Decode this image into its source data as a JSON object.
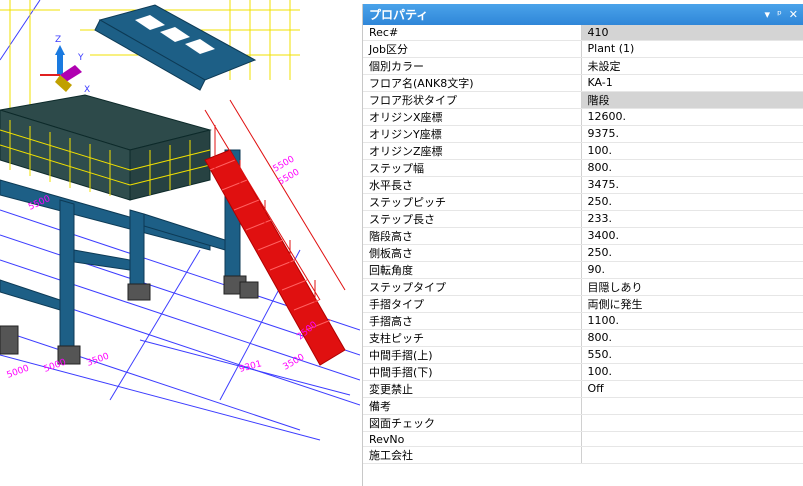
{
  "panel": {
    "title": "プロパティ",
    "controls": [
      "▾",
      "ᵖ",
      "✕"
    ],
    "rows": [
      {
        "key": "Rec#",
        "value": "410"
      },
      {
        "key": "Job区分",
        "value": "Plant (1)"
      },
      {
        "key": "個別カラー",
        "value": "未設定"
      },
      {
        "key": "フロア名(ANK8文字)",
        "value": "KA-1"
      },
      {
        "key": "フロア形状タイプ",
        "value": "階段"
      },
      {
        "key": "オリジンX座標",
        "value": "12600."
      },
      {
        "key": "オリジンY座標",
        "value": "9375."
      },
      {
        "key": "オリジンZ座標",
        "value": "100."
      },
      {
        "key": "ステップ幅",
        "value": "800."
      },
      {
        "key": "水平長さ",
        "value": "3475."
      },
      {
        "key": "ステップピッチ",
        "value": "250."
      },
      {
        "key": "ステップ長さ",
        "value": "233."
      },
      {
        "key": "階段高さ",
        "value": "3400."
      },
      {
        "key": "側板高さ",
        "value": "250."
      },
      {
        "key": "回転角度",
        "value": "90."
      },
      {
        "key": "ステップタイプ",
        "value": "目隠しあり"
      },
      {
        "key": "手摺タイプ",
        "value": "両側に発生"
      },
      {
        "key": "手摺高さ",
        "value": "1100."
      },
      {
        "key": "支柱ピッチ",
        "value": "800."
      },
      {
        "key": "中間手摺(上)",
        "value": "550."
      },
      {
        "key": "中間手摺(下)",
        "value": "100."
      },
      {
        "key": "変更禁止",
        "value": "Off"
      },
      {
        "key": "備考",
        "value": ""
      },
      {
        "key": "図面チェック",
        "value": ""
      },
      {
        "key": "RevNo",
        "value": ""
      },
      {
        "key": "施工会社",
        "value": ""
      }
    ]
  },
  "viewport": {
    "axis_labels": {
      "z": "Z",
      "y": "Y",
      "x": "X"
    },
    "dimensions": [
      "5000",
      "5500",
      "5000",
      "3500",
      "9301",
      "5500",
      "3500",
      "2500",
      "5500"
    ]
  },
  "colors": {
    "steel": "#1d5f86",
    "deck": "#2d4a4a",
    "stair": "#e01010",
    "grid_yellow": "#f0e000",
    "grid_blue": "#3c3cff",
    "dim_magenta": "#ff00ff",
    "title_bar": "#3a93e0"
  }
}
